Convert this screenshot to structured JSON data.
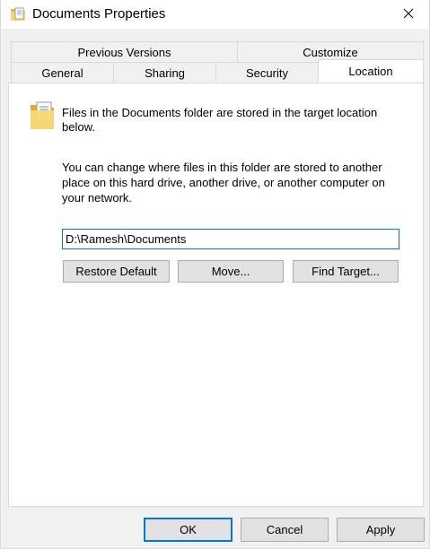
{
  "window": {
    "title": "Documents Properties",
    "close_glyph": "✕"
  },
  "tabs": {
    "row1": [
      {
        "label": "Previous Versions"
      },
      {
        "label": "Customize"
      }
    ],
    "row2": [
      {
        "label": "General"
      },
      {
        "label": "Sharing"
      },
      {
        "label": "Security"
      },
      {
        "label": "Location",
        "active": true
      }
    ]
  },
  "location": {
    "description": "Files in the Documents folder are stored in the target location below.",
    "info": "You can change where files in this folder are stored to another place on this hard drive, another drive, or another computer on your network.",
    "path": "D:\\Ramesh\\Documents",
    "restore_label": "Restore Default",
    "move_label": "Move...",
    "find_target_label": "Find Target..."
  },
  "footer": {
    "ok_label": "OK",
    "cancel_label": "Cancel",
    "apply_label": "Apply"
  },
  "colors": {
    "accent": "#0078d7",
    "button_face": "#e1e1e1",
    "folder_yellow": "#f8d775"
  }
}
